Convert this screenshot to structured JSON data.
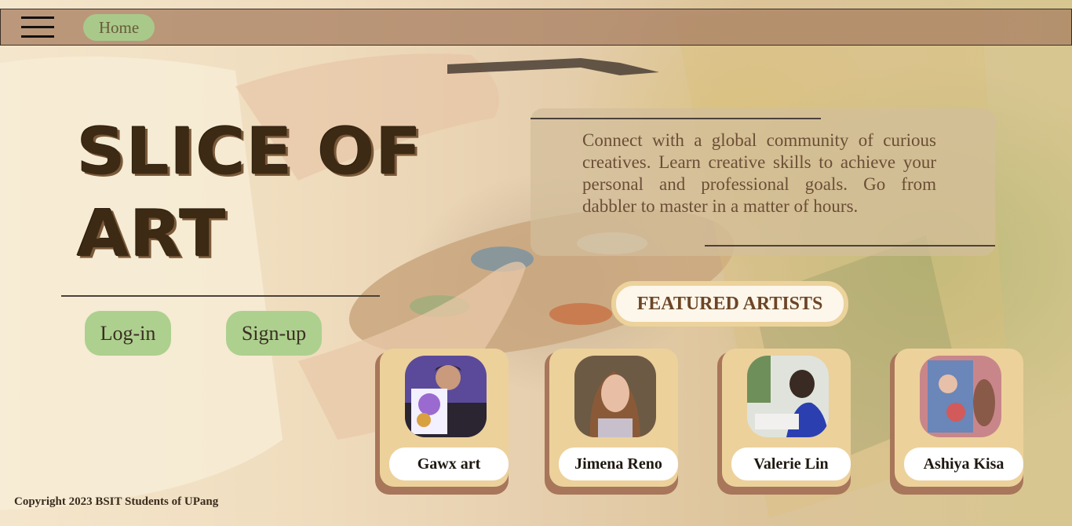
{
  "nav": {
    "home_label": "Home"
  },
  "hero": {
    "title": "SLICE OF ART",
    "login_label": "Log-in",
    "signup_label": "Sign-up"
  },
  "intro": {
    "text": "Connect with a global community of curious creatives. Learn creative skills to achieve your personal and professional goals. Go from dabbler to master in a matter of hours."
  },
  "featured": {
    "heading": "FEATURED ARTISTS",
    "artists": [
      {
        "name": "Gawx art"
      },
      {
        "name": "Jimena Reno"
      },
      {
        "name": "Valerie Lin"
      },
      {
        "name": "Ashiya Kisa"
      }
    ]
  },
  "footer": {
    "copyright": "Copyright 2023 BSIT Students of UPang"
  },
  "colors": {
    "topbar": "#aa8264",
    "accent_green": "#add08e",
    "card": "#ecd19b",
    "card_shadow": "#a8765a",
    "title": "#3d2a14"
  }
}
